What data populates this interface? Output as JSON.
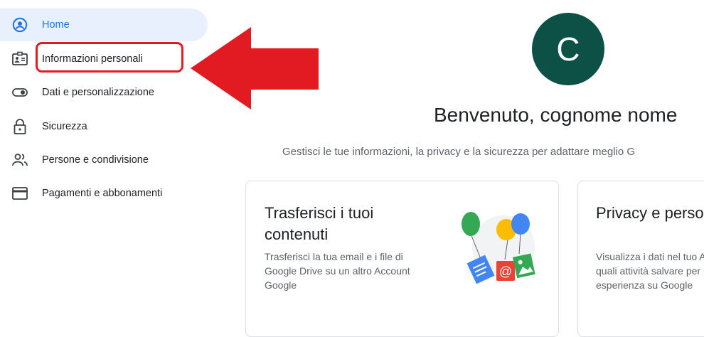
{
  "sidebar": {
    "items": [
      {
        "label": "Home",
        "icon": "account-circle-icon",
        "active": true
      },
      {
        "label": "Informazioni personali",
        "icon": "id-card-icon",
        "active": false
      },
      {
        "label": "Dati e personalizzazione",
        "icon": "toggle-icon",
        "active": false
      },
      {
        "label": "Sicurezza",
        "icon": "lock-icon",
        "active": false
      },
      {
        "label": "Persone e condivisione",
        "icon": "people-icon",
        "active": false
      },
      {
        "label": "Pagamenti e abbonamenti",
        "icon": "credit-card-icon",
        "active": false
      }
    ]
  },
  "profile": {
    "avatar_letter": "C",
    "avatar_color": "#0d5045",
    "welcome": "Benvenuto, cognome nome",
    "subtitle": "Gestisci le tue informazioni, la privacy e la sicurezza per adattare meglio G"
  },
  "cards": [
    {
      "title": "Trasferisci i tuoi contenuti",
      "body": "Trasferisci la tua email e i file di Google Drive su un altro Account Google"
    },
    {
      "title": "Privacy e personalizzazione",
      "body": "Visualizza i dati nel tuo Account Google e scegli quali attività salvare per personalizzare la tua esperienza su Google"
    }
  ],
  "colors": {
    "accent": "#1a73e8",
    "active_bg": "#e8f0fe",
    "annotation_red": "#e21b23"
  }
}
